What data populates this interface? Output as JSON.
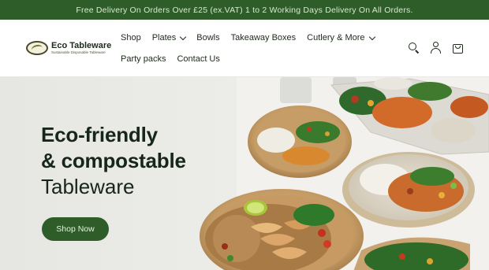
{
  "announcement": "Free Delivery On Orders Over £25 (ex.VAT) 1 to 2 Working Days Delivery On All Orders.",
  "logo": {
    "title": "Eco Tableware",
    "tagline": "Sustainable Disposable Tableware"
  },
  "nav": {
    "row1": [
      {
        "label": "Shop",
        "dropdown": false
      },
      {
        "label": "Plates",
        "dropdown": true
      },
      {
        "label": "Bowls",
        "dropdown": false
      },
      {
        "label": "Takeaway Boxes",
        "dropdown": false
      },
      {
        "label": "Cutlery & More",
        "dropdown": true
      }
    ],
    "row2": [
      {
        "label": "Party packs",
        "dropdown": false
      },
      {
        "label": "Contact Us",
        "dropdown": false
      }
    ]
  },
  "header_icons": [
    "search-icon",
    "account-icon",
    "cart-icon"
  ],
  "hero": {
    "line1": "Eco-friendly",
    "line2": "& compostable",
    "line3": "Tableware",
    "button": "Shop Now"
  },
  "colors": {
    "brand_green": "#2f5d2a",
    "dark_text": "#16271a"
  }
}
